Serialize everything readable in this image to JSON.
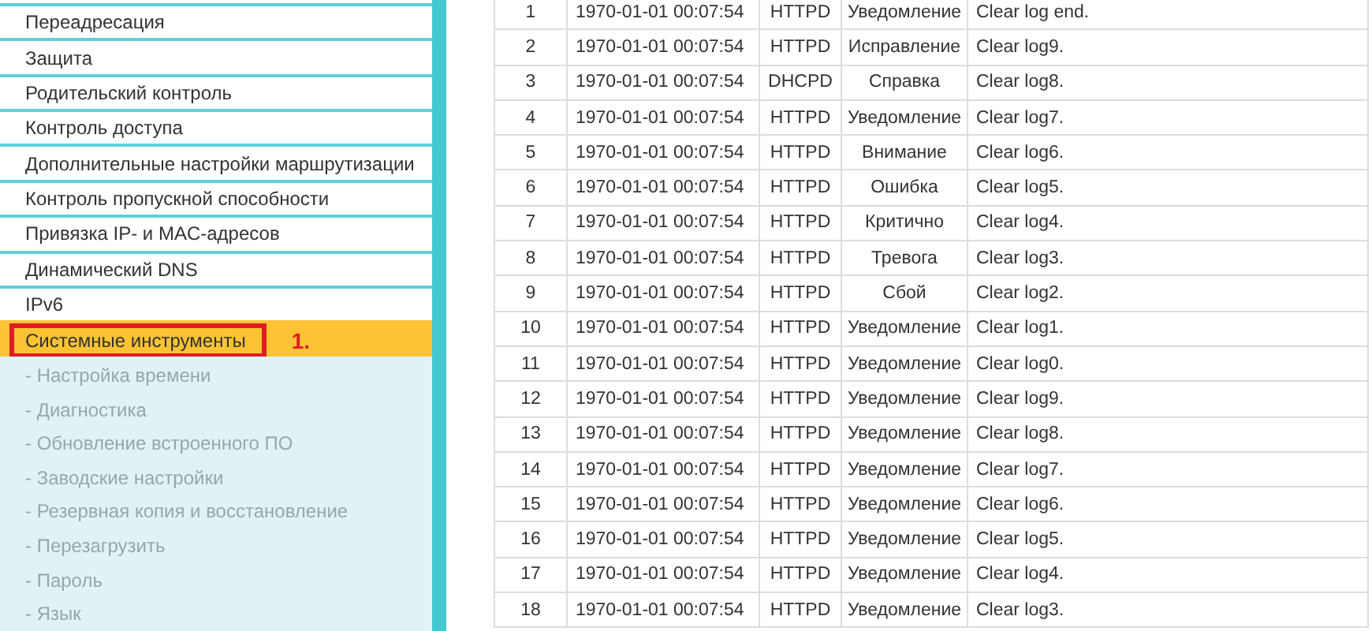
{
  "sidebar": {
    "items": [
      {
        "label": "Переадресация",
        "selected": false
      },
      {
        "label": "Защита",
        "selected": false
      },
      {
        "label": "Родительский контроль",
        "selected": false
      },
      {
        "label": "Контроль доступа",
        "selected": false
      },
      {
        "label": "Дополнительные настройки маршрутизации",
        "selected": false
      },
      {
        "label": "Контроль пропускной способности",
        "selected": false
      },
      {
        "label": "Привязка IP- и MAC-адресов",
        "selected": false
      },
      {
        "label": "Динамический DNS",
        "selected": false
      },
      {
        "label": "IPv6",
        "selected": false
      },
      {
        "label": "Системные инструменты",
        "selected": true,
        "expanded": true,
        "annotation": "1.",
        "children": [
          {
            "label": "- Настройка времени",
            "selected": false
          },
          {
            "label": "- Диагностика",
            "selected": false
          },
          {
            "label": "- Обновление встроенного ПО",
            "selected": false
          },
          {
            "label": "- Заводские настройки",
            "selected": false
          },
          {
            "label": "- Резервная копия и восстановление",
            "selected": false
          },
          {
            "label": "- Перезагрузить",
            "selected": false
          },
          {
            "label": "- Пароль",
            "selected": false
          },
          {
            "label": "- Язык",
            "selected": false
          }
        ]
      }
    ]
  },
  "log_table": {
    "rows": [
      [
        "1",
        "1970-01-01 00:07:54",
        "HTTPD",
        "Уведомление",
        "Clear log end."
      ],
      [
        "2",
        "1970-01-01 00:07:54",
        "HTTPD",
        "Исправление",
        "Clear log9."
      ],
      [
        "3",
        "1970-01-01 00:07:54",
        "DHCPD",
        "Справка",
        "Clear log8."
      ],
      [
        "4",
        "1970-01-01 00:07:54",
        "HTTPD",
        "Уведомление",
        "Clear log7."
      ],
      [
        "5",
        "1970-01-01 00:07:54",
        "HTTPD",
        "Внимание",
        "Clear log6."
      ],
      [
        "6",
        "1970-01-01 00:07:54",
        "HTTPD",
        "Ошибка",
        "Clear log5."
      ],
      [
        "7",
        "1970-01-01 00:07:54",
        "HTTPD",
        "Критично",
        "Clear log4."
      ],
      [
        "8",
        "1970-01-01 00:07:54",
        "HTTPD",
        "Тревога",
        "Clear log3."
      ],
      [
        "9",
        "1970-01-01 00:07:54",
        "HTTPD",
        "Сбой",
        "Clear log2."
      ],
      [
        "10",
        "1970-01-01 00:07:54",
        "HTTPD",
        "Уведомление",
        "Clear log1."
      ],
      [
        "11",
        "1970-01-01 00:07:54",
        "HTTPD",
        "Уведомление",
        "Clear log0."
      ],
      [
        "12",
        "1970-01-01 00:07:54",
        "HTTPD",
        "Уведомление",
        "Clear log9."
      ],
      [
        "13",
        "1970-01-01 00:07:54",
        "HTTPD",
        "Уведомление",
        "Clear log8."
      ],
      [
        "14",
        "1970-01-01 00:07:54",
        "HTTPD",
        "Уведомление",
        "Clear log7."
      ],
      [
        "15",
        "1970-01-01 00:07:54",
        "HTTPD",
        "Уведомление",
        "Clear log6."
      ],
      [
        "16",
        "1970-01-01 00:07:54",
        "HTTPD",
        "Уведомление",
        "Clear log5."
      ],
      [
        "17",
        "1970-01-01 00:07:54",
        "HTTPD",
        "Уведомление",
        "Clear log4."
      ],
      [
        "18",
        "1970-01-01 00:07:54",
        "HTTPD",
        "Уведомление",
        "Clear log3."
      ]
    ]
  }
}
